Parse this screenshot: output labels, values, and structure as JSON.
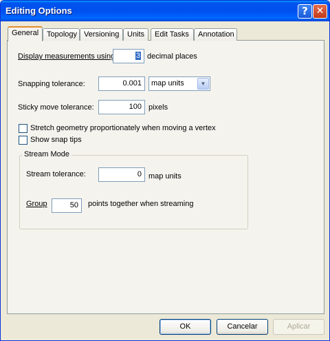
{
  "window": {
    "title": "Editing Options",
    "help_glyph": "?",
    "close_glyph": "✕"
  },
  "tabs": [
    {
      "label": "General",
      "active": true
    },
    {
      "label": "Topology"
    },
    {
      "label": "Versioning"
    },
    {
      "label": "Units"
    },
    {
      "label": "Edit Tasks"
    },
    {
      "label": "Annotation"
    }
  ],
  "general": {
    "display_label": "Display measurements using",
    "decimal_places_value": "3",
    "decimal_places_suffix": "decimal places",
    "snapping_label": "Snapping tolerance:",
    "snapping_value": "0.001",
    "snapping_units_selected": "map units",
    "sticky_label": "Sticky move tolerance:",
    "sticky_value": "100",
    "sticky_suffix": "pixels",
    "stretch_label": "Stretch geometry proportionately when moving a vertex",
    "stretch_checked": false,
    "snaptips_label": "Show snap tips",
    "snaptips_checked": false
  },
  "stream_mode": {
    "group_title": "Stream Mode",
    "tolerance_label": "Stream tolerance:",
    "tolerance_value": "0",
    "tolerance_suffix": "map units",
    "group_label": "Group",
    "group_value": "50",
    "group_suffix": "points together when streaming"
  },
  "buttons": {
    "ok": "OK",
    "cancel": "Cancelar",
    "apply": "Aplicar"
  },
  "icons": {
    "dropdown": "chevron-down-icon"
  }
}
